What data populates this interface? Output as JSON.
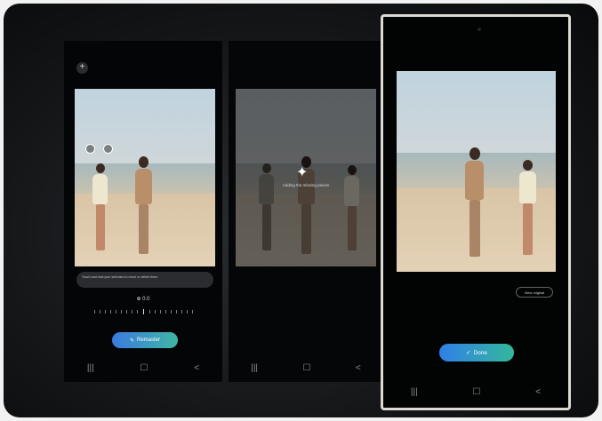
{
  "screen1": {
    "add_icon": "plus-icon",
    "toast_text": "Touch and hold your selection to move or delete them.",
    "angle_label": "0.0",
    "remaster_button": "Remaster",
    "nav": [
      "|||",
      "☐",
      "<"
    ]
  },
  "screen2": {
    "status_text": "Adding the missing pieces",
    "nav": [
      "|||",
      "☐",
      "<"
    ]
  },
  "screen3": {
    "view_original_button": "View original",
    "done_button": "Done",
    "nav": [
      "|||",
      "☐",
      "<"
    ]
  },
  "colors": {
    "accent_gradient_start": "#3b7be0",
    "accent_gradient_end": "#3fb6a3",
    "phone_bezel": "#ddd9d3",
    "background": "#141618"
  }
}
